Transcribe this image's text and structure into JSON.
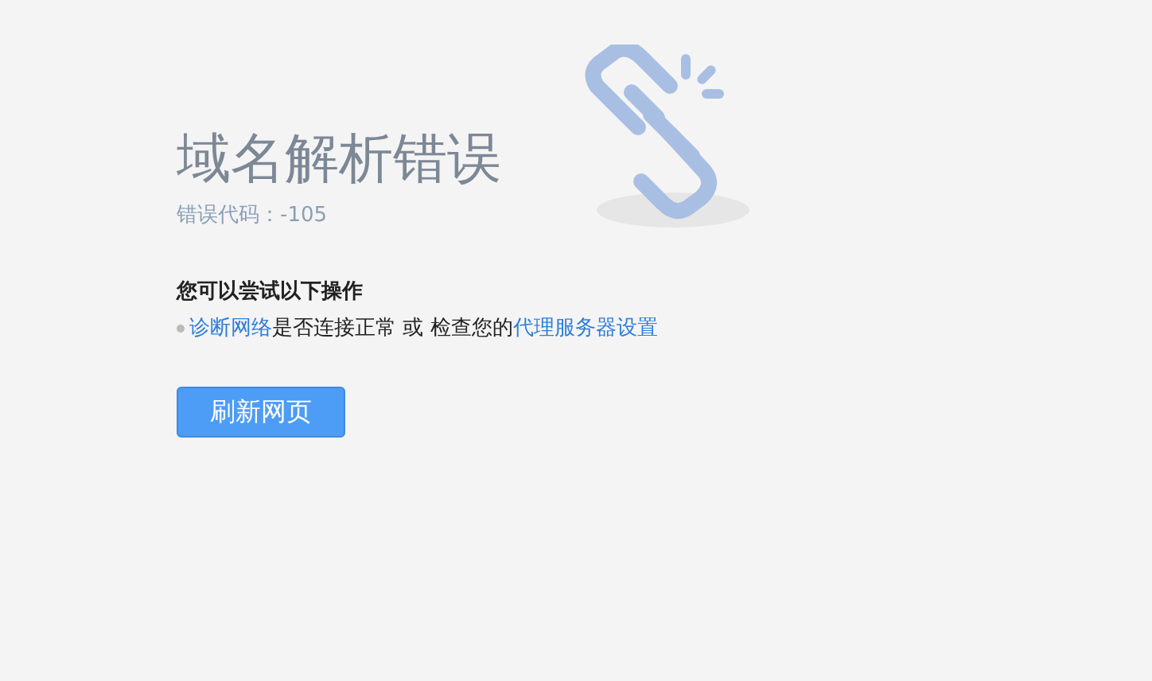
{
  "title": "域名解析错误",
  "error_code": "错误代码：-105",
  "suggestions_heading": "您可以尝试以下操作",
  "suggestion": [
    {
      "kind": "link",
      "text": "诊断网络"
    },
    {
      "kind": "text",
      "text": "是否连接正常 或 检查您的"
    },
    {
      "kind": "link",
      "text": "代理服务器设置"
    }
  ],
  "reload_button": "刷新网页"
}
